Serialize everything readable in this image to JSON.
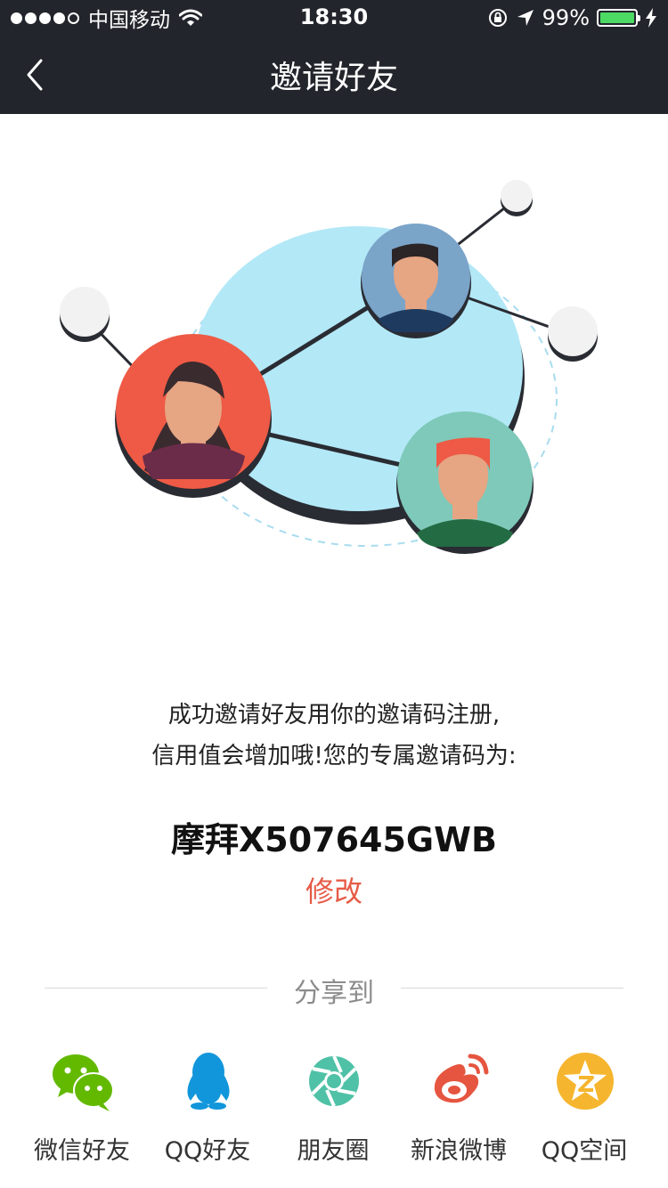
{
  "status_bar": {
    "carrier": "中国移动",
    "time": "18:30",
    "battery_text": "99%",
    "battery_level": 0.99,
    "colors": {
      "battery": "#4cd964"
    }
  },
  "nav": {
    "title": "邀请好友",
    "back_icon": "chevron-left-icon"
  },
  "invite": {
    "line1": "成功邀请好友用你的邀请码注册,",
    "line2": "信用值会增加哦!您的专属邀请码为:",
    "code": "摩拜X507645GWB",
    "edit_label": "修改"
  },
  "share": {
    "title": "分享到",
    "items": [
      {
        "label": "微信好友",
        "icon": "wechat-icon",
        "color": "#62b900"
      },
      {
        "label": "QQ好友",
        "icon": "qq-icon",
        "color": "#1296db"
      },
      {
        "label": "朋友圈",
        "icon": "moments-icon",
        "color": "#4fc1a6"
      },
      {
        "label": "新浪微博",
        "icon": "weibo-icon",
        "color": "#e6162d"
      },
      {
        "label": "QQ空间",
        "icon": "qzone-icon",
        "color": "#f5b52e"
      }
    ]
  },
  "colors": {
    "header_bg": "#22252b",
    "accent": "#e65b46"
  }
}
